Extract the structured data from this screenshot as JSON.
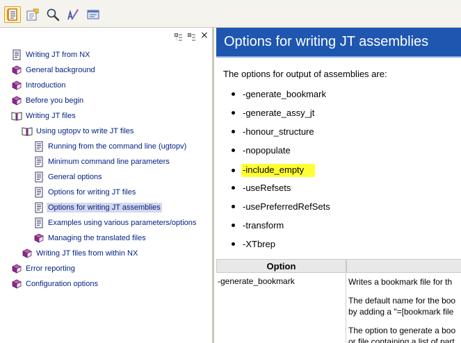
{
  "toolbar": {
    "buttons": [
      {
        "name": "contents-tab-icon",
        "active": true
      },
      {
        "name": "index-tab-icon",
        "active": false
      },
      {
        "name": "search-tab-icon",
        "active": false
      },
      {
        "name": "glossary-tab-icon",
        "active": false
      },
      {
        "name": "mail-icon",
        "active": false
      }
    ]
  },
  "nav": {
    "close_label": "×",
    "items": [
      {
        "label": "Writing JT from NX",
        "icon": "page"
      },
      {
        "label": "General background",
        "icon": "book"
      },
      {
        "label": "Introduction",
        "icon": "book"
      },
      {
        "label": "Before you begin",
        "icon": "book"
      },
      {
        "label": "Writing JT files",
        "icon": "openbook"
      },
      {
        "label": "Using ugtopv to write JT files",
        "icon": "openbook"
      },
      {
        "label": "Running from the command line (ugtopv)",
        "icon": "page"
      },
      {
        "label": "Minimum command line parameters",
        "icon": "page"
      },
      {
        "label": "General options",
        "icon": "page"
      },
      {
        "label": "Options for writing JT files",
        "icon": "page"
      },
      {
        "label": "Options for writing JT assemblies",
        "icon": "page",
        "selected": true
      },
      {
        "label": "Examples using various parameters/options",
        "icon": "page"
      },
      {
        "label": "Managing the translated files",
        "icon": "book"
      },
      {
        "label": "Writing JT files from within NX",
        "icon": "book"
      },
      {
        "label": "Error reporting",
        "icon": "book"
      },
      {
        "label": "Configuration options",
        "icon": "book"
      }
    ]
  },
  "content": {
    "title": "Options for writing JT assemblies",
    "intro": "The options for output of assemblies are:",
    "options": [
      "-generate_bookmark",
      "-generate_assy_jt",
      "-honour_structure",
      "-nopopulate",
      "-include_empty",
      "-useRefsets",
      "-usePreferredRefSets",
      "-transform",
      "-XTbrep"
    ],
    "highlighted_option": "-include_empty",
    "table": {
      "headers": [
        "Option",
        ""
      ],
      "rows": [
        {
          "option": "-generate_bookmark",
          "lines": [
            "Writes a bookmark file for th",
            "",
            "The default name for the boo",
            "by adding a \"=[bookmark file",
            "",
            "The option to generate a boo",
            "or file containing a list of part"
          ]
        }
      ]
    }
  },
  "colors": {
    "title_bar": "#1e56b0",
    "highlight": "#ffff33",
    "link": "#001f82",
    "selected_bg": "#d4d8ec"
  }
}
